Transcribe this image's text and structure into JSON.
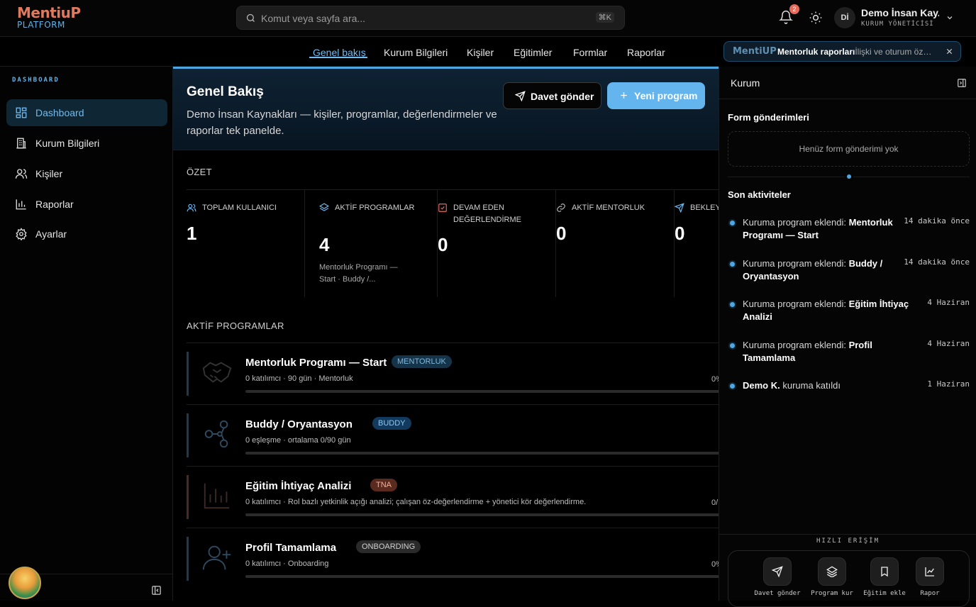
{
  "brand": {
    "name_part1": "Mentiu",
    "name_part2": "P",
    "subtitle": "PLATFORM"
  },
  "search": {
    "placeholder": "Komut veya sayfa ara...",
    "shortcut": "⌘K"
  },
  "notifications": {
    "count": "2"
  },
  "user": {
    "initials": "Dİ",
    "name": "Demo İnsan Kay...",
    "role": "KURUM YÖNETİCİSİ"
  },
  "nav": {
    "tabs": [
      {
        "label": "Genel bakış",
        "active": true
      },
      {
        "label": "Kurum Bilgileri"
      },
      {
        "label": "Kişiler"
      },
      {
        "label": "Eğitimler"
      },
      {
        "label": "Formlar"
      },
      {
        "label": "Raporlar"
      }
    ]
  },
  "notice": {
    "logo": "MentiUP",
    "title": "Mentorluk raporları",
    "desc": "· İlişki ve oturum özetl..."
  },
  "sidebar": {
    "heading": "DASHBOARD",
    "items": [
      {
        "label": "Dashboard",
        "icon": "grid-icon",
        "active": true
      },
      {
        "label": "Kurum Bilgileri",
        "icon": "building-icon"
      },
      {
        "label": "Kişiler",
        "icon": "users-icon"
      },
      {
        "label": "Raporlar",
        "icon": "bar-chart-icon"
      },
      {
        "label": "Ayarlar",
        "icon": "gear-icon"
      }
    ]
  },
  "hero": {
    "title": "Genel Bakış",
    "desc": "Demo İnsan Kaynakları — kişiler, programlar, değerlendirmeler ve raporlar tek panelde.",
    "invite_label": "Davet gönder",
    "new_label": "Yeni program"
  },
  "summary": {
    "title": "ÖZET",
    "stats": [
      {
        "label": "TOPLAM KULLANICI",
        "value": "1",
        "sub": ""
      },
      {
        "label": "AKTİF PROGRAMLAR",
        "value": "4",
        "sub": "Mentorluk Programı — Start · Buddy /..."
      },
      {
        "label": "DEVAM EDEN DEĞERLENDİRME",
        "value": "0",
        "sub": ""
      },
      {
        "label": "AKTİF MENTORLUK",
        "value": "0",
        "sub": ""
      },
      {
        "label": "BEKLEY",
        "value": "0",
        "sub": ""
      }
    ]
  },
  "programs": {
    "title": "AKTİF PROGRAMLAR",
    "items": [
      {
        "name": "Mentorluk Programı — Start",
        "badge": "MENTORLUK",
        "meta": "0 katılımcı · 90 gün · Mentorluk",
        "pct": "0%",
        "progress": 0,
        "bar_color": "#1e3a4e",
        "badge_bg": "#163449",
        "badge_fg": "#7fb8dc"
      },
      {
        "name": "Buddy / Oryantasyon",
        "badge": "BUDDY",
        "meta": "0 eşleşme · ortalama 0/90 gün",
        "pct": "",
        "progress": 0,
        "bar_color": "#1e3a4e",
        "badge_bg": "#123a5e",
        "badge_fg": "#8ec9f2"
      },
      {
        "name": "Eğitim İhtiyaç Analizi",
        "badge": "TNA",
        "meta": "0 katılımcı · Rol bazlı yetkinlik açığı analizi; çalışan öz-değerlendirme + yönetici kör değerlendirme.",
        "pct": "0/",
        "progress": 0,
        "bar_color": "#4a2a22",
        "badge_bg": "#5a2a1e",
        "badge_fg": "#f0b09a"
      },
      {
        "name": "Profil Tamamlama",
        "badge": "ONBOARDING",
        "meta": "0 katılımcı · Onboarding",
        "pct": "0%",
        "progress": 0,
        "bar_color": "#1e3a4e",
        "badge_bg": "#2a2a2a",
        "badge_fg": "#d0d0d0"
      }
    ]
  },
  "right_panel": {
    "title": "Kurum",
    "forms_title": "Form gönderimleri",
    "forms_empty": "Henüz form gönderimi yok",
    "activity_title": "Son aktiviteler",
    "activities": [
      {
        "text": "Kuruma program eklendi: ",
        "bold": "Mentorluk Programı — Start",
        "time": "14 dakika önce"
      },
      {
        "text": "Kuruma program eklendi: ",
        "bold": "Buddy / Oryantasyon",
        "time": "14 dakika önce"
      },
      {
        "text": "Kuruma program eklendi: ",
        "bold": "Eğitim İhtiyaç Analizi",
        "time": "4 Haziran"
      },
      {
        "text": "Kuruma program eklendi: ",
        "bold": "Profil Tamamlama",
        "time": "4 Haziran"
      },
      {
        "text": " kuruma katıldı",
        "bold": "Demo K.",
        "time": "1 Haziran",
        "bold_first": true
      }
    ],
    "quick_title": "HIZLI ERİŞİM",
    "quick": [
      {
        "label": "Davet gönder",
        "icon": "send-icon"
      },
      {
        "label": "Program kur",
        "icon": "layers-icon"
      },
      {
        "label": "Eğitim ekle",
        "icon": "bookmark-icon"
      },
      {
        "label": "Rapor",
        "icon": "line-chart-icon"
      }
    ]
  },
  "colors": {
    "accent": "#64b5ee",
    "background": "#000000",
    "brand_orange": "#e07a5f"
  }
}
